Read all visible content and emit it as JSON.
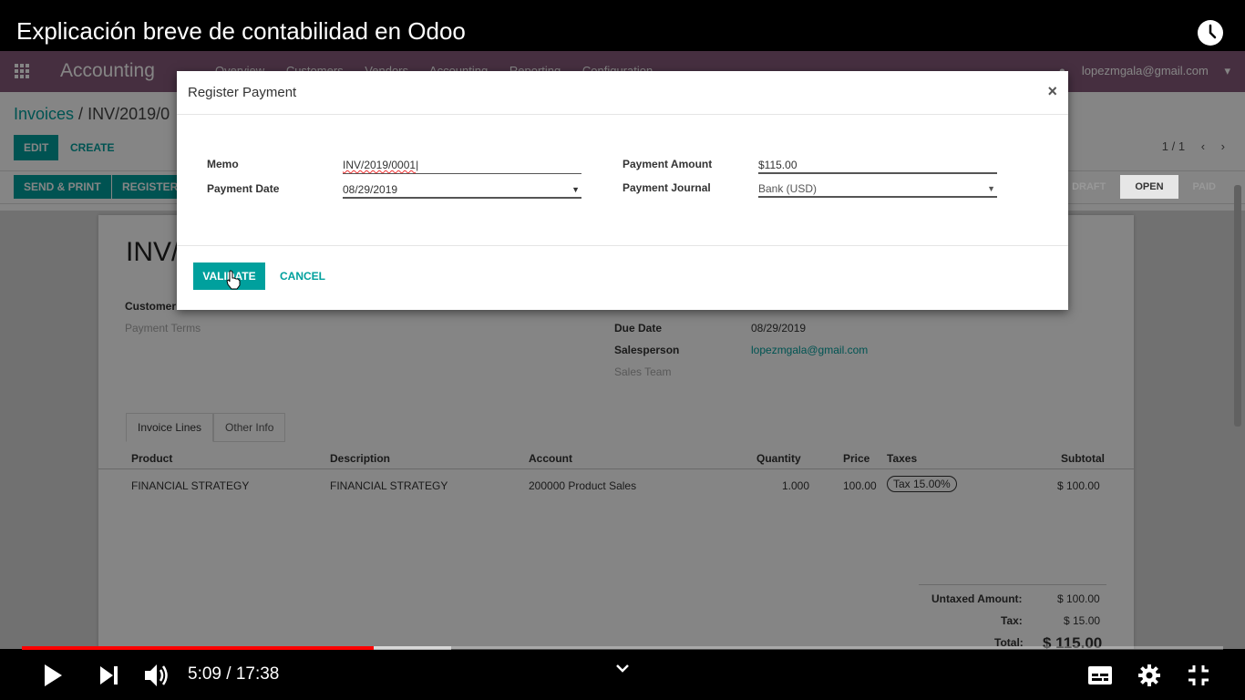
{
  "video": {
    "title": "Explicación breve de contabilidad en Odoo",
    "time_current": "5:09",
    "time_total": "17:38",
    "time_display": "5:09 / 17:38",
    "progress_fraction": 0.293,
    "buffered_fraction": 0.357
  },
  "odoo": {
    "brand": "Accounting",
    "menu": [
      "Overview",
      "Customers",
      "Vendors",
      "Accounting",
      "Reporting",
      "Configuration"
    ],
    "user": "lopezmgala@gmail.com",
    "breadcrumb_root": "Invoices",
    "breadcrumb_sep": " / ",
    "breadcrumb_current": "INV/2019/0",
    "buttons": {
      "edit": "EDIT",
      "create": "CREATE",
      "send_print": "SEND & PRINT",
      "register": "REGISTER"
    },
    "pager": "1 / 1",
    "statuses": [
      {
        "label": "DRAFT",
        "active": false
      },
      {
        "label": "OPEN",
        "active": true
      },
      {
        "label": "PAID",
        "active": false
      }
    ],
    "invoice": {
      "name": "INV/",
      "customer_label": "Customer",
      "payment_terms_label": "Payment Terms",
      "due_date_label": "Due Date",
      "due_date": "08/29/2019",
      "salesperson_label": "Salesperson",
      "salesperson": "lopezmgala@gmail.com",
      "sales_team_label": "Sales Team",
      "tabs": [
        "Invoice Lines",
        "Other Info"
      ],
      "columns": [
        "Product",
        "Description",
        "Account",
        "Quantity",
        "Price",
        "Taxes",
        "Subtotal"
      ],
      "line": {
        "product": "FINANCIAL STRATEGY",
        "description": "FINANCIAL STRATEGY",
        "account": "200000 Product Sales",
        "quantity": "1.000",
        "price": "100.00",
        "taxes": "Tax 15.00%",
        "subtotal": "$ 100.00"
      },
      "untaxed_label": "Untaxed Amount:",
      "untaxed": "$ 100.00",
      "tax_label": "Tax:",
      "tax": "$ 15.00",
      "total_label": "Total:",
      "total": "$ 115.00"
    }
  },
  "modal": {
    "title": "Register Payment",
    "close": "×",
    "memo_label": "Memo",
    "memo_value": "INV/2019/0001",
    "payment_date_label": "Payment Date",
    "payment_date": "08/29/2019",
    "payment_amount_label": "Payment Amount",
    "payment_amount": "$115.00",
    "payment_journal_label": "Payment Journal",
    "payment_journal": "Bank (USD)",
    "validate": "VALIDATE",
    "cancel": "CANCEL"
  },
  "colors": {
    "odoo_primary": "#875a7b",
    "odoo_teal": "#00a09d",
    "yt_progress": "#ff0000"
  },
  "icons": [
    "apps-grid-icon",
    "clock-icon",
    "play-icon",
    "next-icon",
    "volume-icon",
    "chevron-down-icon",
    "subtitles-icon",
    "settings-gear-icon",
    "exit-fullscreen-icon",
    "hand-cursor-icon",
    "dropdown-caret-icon"
  ]
}
